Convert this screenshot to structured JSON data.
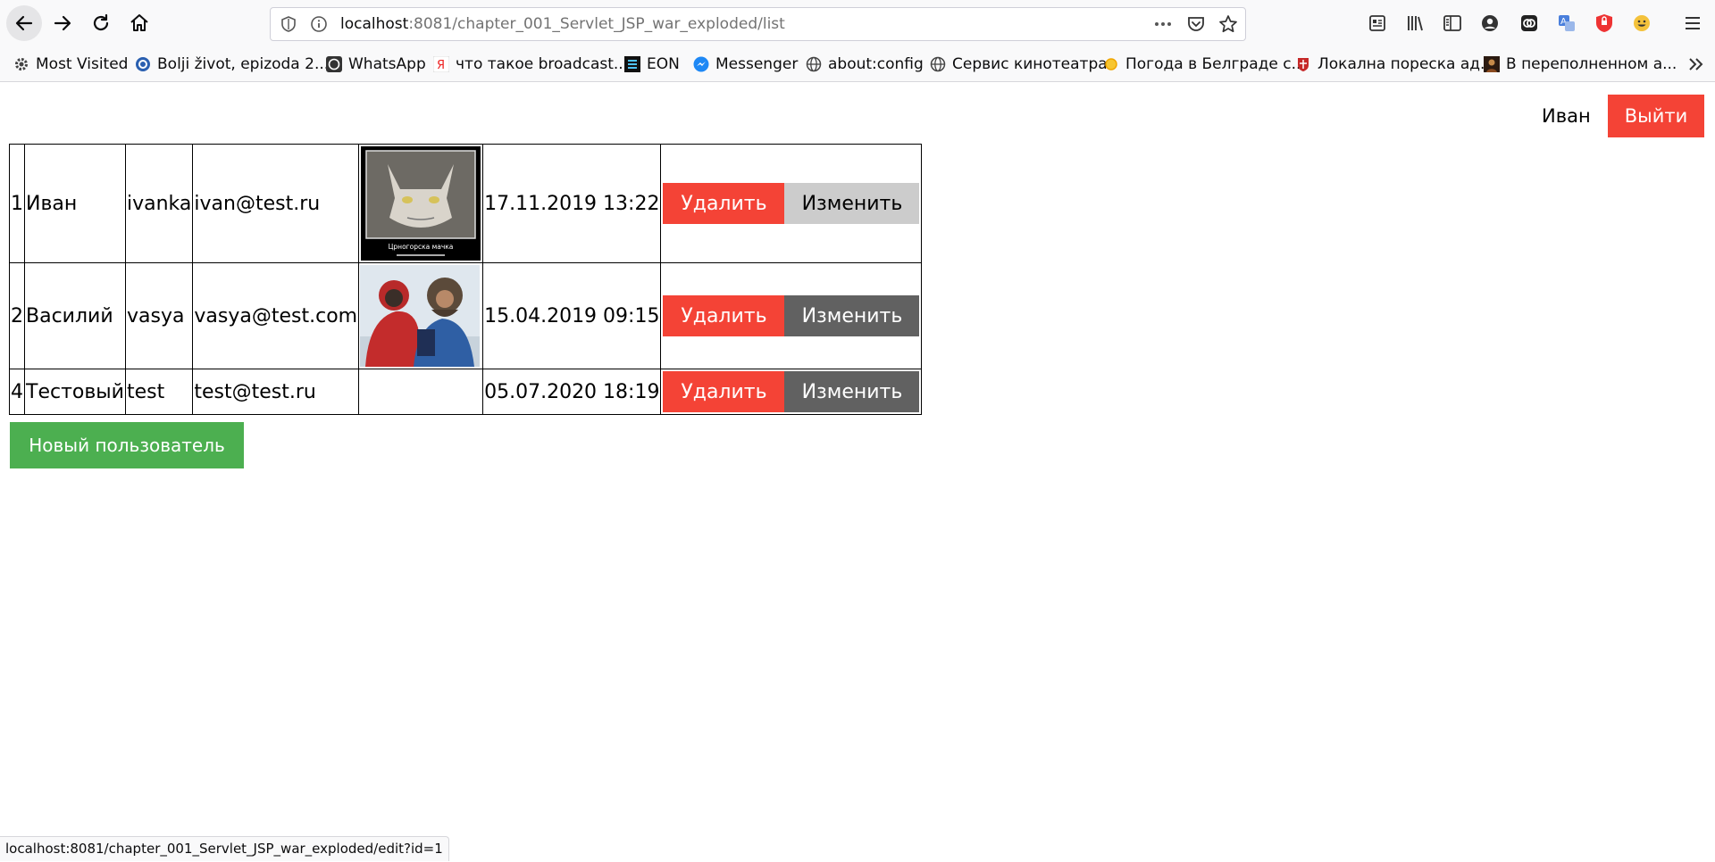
{
  "browser": {
    "url_host": "localhost",
    "url_path": ":8081/chapter_001_Servlet_JSP_war_exploded/list",
    "status_url": "localhost:8081/chapter_001_Servlet_JSP_war_exploded/edit?id=1"
  },
  "bookmarks": [
    {
      "label": "Most Visited",
      "icon": "gear-icon"
    },
    {
      "label": "Bolji život, epizoda 2...",
      "icon": "play-icon"
    },
    {
      "label": "WhatsApp",
      "icon": "whatsapp-icon"
    },
    {
      "label": "что такое broadcast...",
      "icon": "yandex-icon"
    },
    {
      "label": "EON",
      "icon": "eon-icon"
    },
    {
      "label": "Messenger",
      "icon": "messenger-icon"
    },
    {
      "label": "about:config",
      "icon": "globe-icon"
    },
    {
      "label": "Сервис кинотеатра",
      "icon": "globe-icon"
    },
    {
      "label": "Погода в Белграде с...",
      "icon": "sun-icon"
    },
    {
      "label": "Локална пореска ад...",
      "icon": "crest-icon"
    },
    {
      "label": "В переполненном а...",
      "icon": "portrait-icon"
    }
  ],
  "header": {
    "user_name": "Иван",
    "logout_label": "Выйти"
  },
  "users": [
    {
      "id": "1",
      "name": "Иван",
      "login": "ivanka",
      "email": "ivan@test.ru",
      "photo": "cat-photo",
      "photo_caption": "Црногорска мачка",
      "created": "17.11.2019 13:22"
    },
    {
      "id": "2",
      "name": "Василий",
      "login": "vasya",
      "email": "vasya@test.com",
      "photo": "dog-and-man-photo",
      "created": "15.04.2019 09:15"
    },
    {
      "id": "4",
      "name": "Тестовый",
      "login": "test",
      "email": "test@test.ru",
      "photo": "",
      "created": "05.07.2020 18:19"
    }
  ],
  "actions": {
    "delete_label": "Удалить",
    "edit_label": "Изменить"
  },
  "new_user_label": "Новый пользователь",
  "colors": {
    "delete": "#f44336",
    "edit": "#616161",
    "edit_hover": "#cccccc",
    "new_user": "#4caf50",
    "logout": "#f44336"
  }
}
